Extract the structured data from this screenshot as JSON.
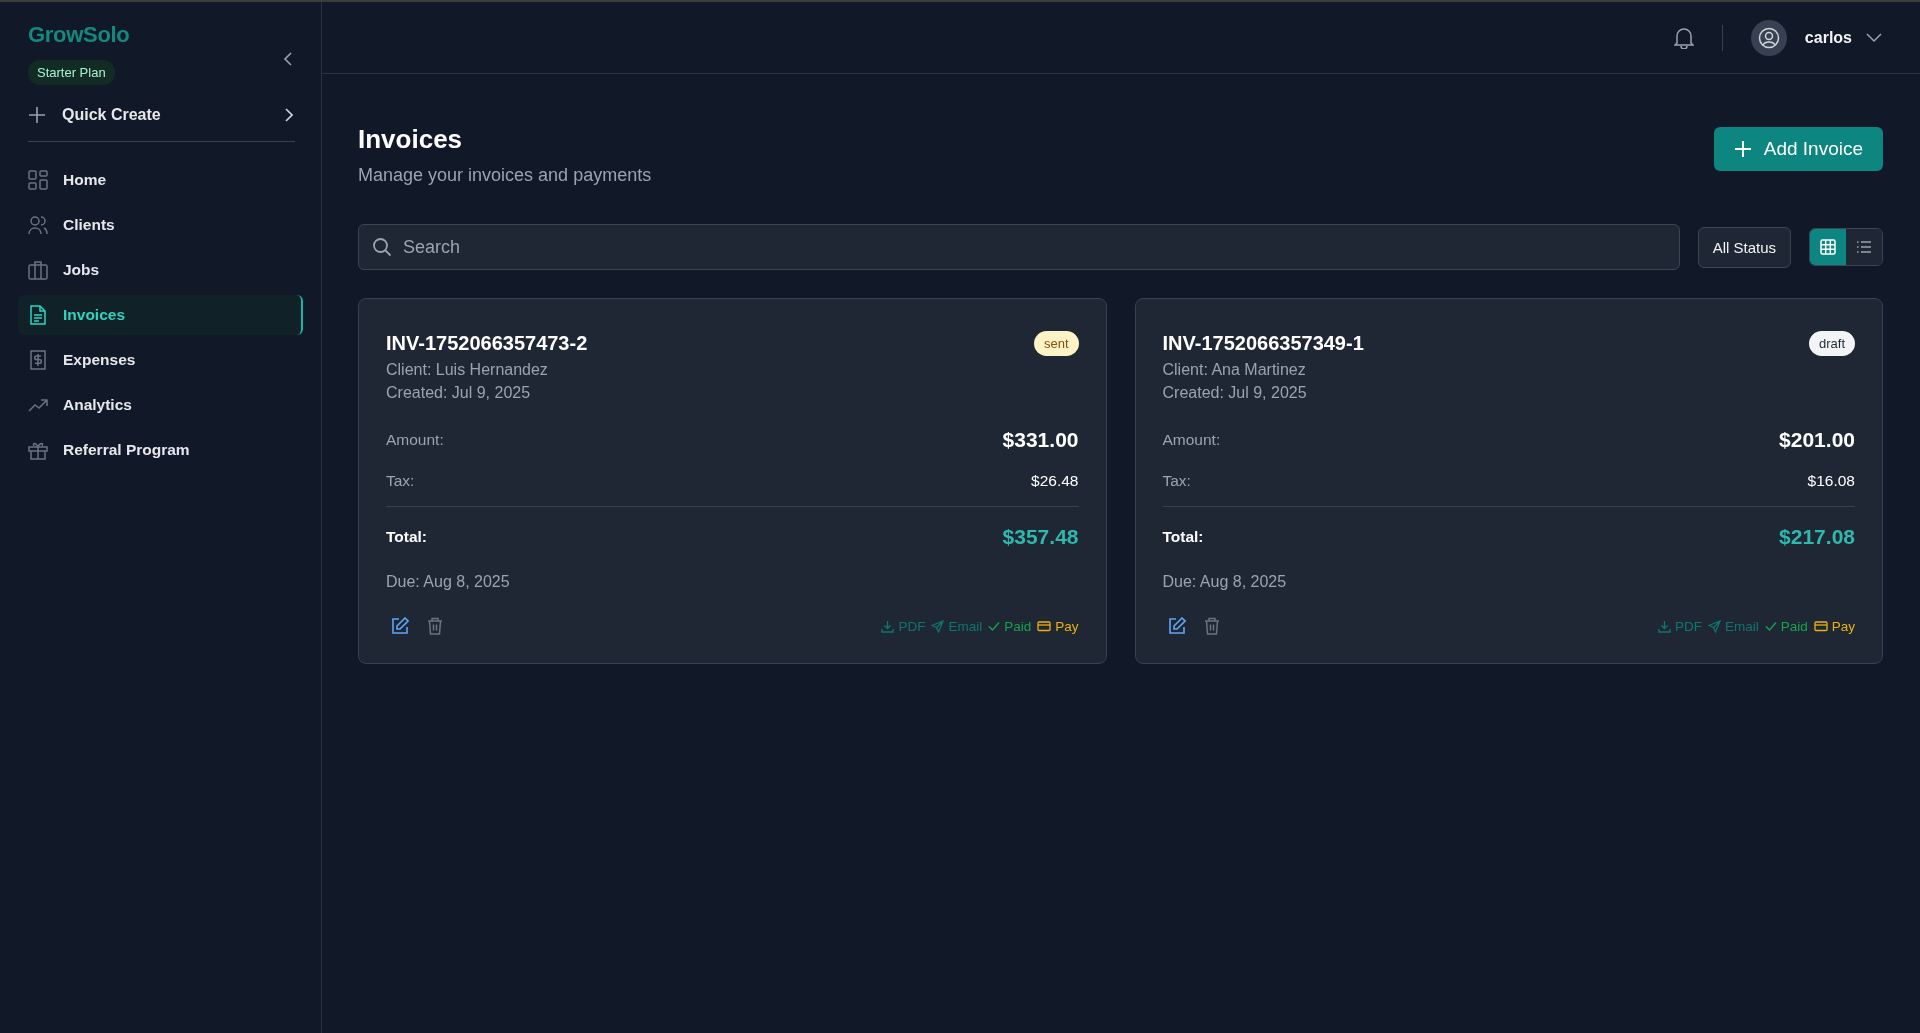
{
  "sidebar": {
    "brand": "GrowSolo",
    "plan": "Starter Plan",
    "quick_create": "Quick Create",
    "items": [
      {
        "label": "Home",
        "selected": false
      },
      {
        "label": "Clients",
        "selected": false
      },
      {
        "label": "Jobs",
        "selected": false
      },
      {
        "label": "Invoices",
        "selected": true
      },
      {
        "label": "Expenses",
        "selected": false
      },
      {
        "label": "Analytics",
        "selected": false
      },
      {
        "label": "Referral Program",
        "selected": false
      }
    ]
  },
  "header": {
    "user": "carlos"
  },
  "page": {
    "title": "Invoices",
    "subtitle": "Manage your invoices and payments",
    "add_button": "Add Invoice",
    "search": {
      "placeholder": "Search"
    },
    "status_filter": "All Status",
    "views": [
      {
        "kind": "grid",
        "selected": true
      },
      {
        "kind": "list",
        "selected": false
      }
    ]
  },
  "invoices": [
    {
      "number": "INV-1752066357473-2",
      "status": "sent",
      "client": "Client: Luis Hernandez",
      "created": "Created: Jul 9, 2025",
      "amount_label": "Amount:",
      "amount": "$331.00",
      "tax_label": "Tax:",
      "tax": "$26.48",
      "total_label": "Total:",
      "total": "$357.48",
      "due": "Due: Aug 8, 2025",
      "actions": [
        {
          "kind": "pdf",
          "label": "PDF"
        },
        {
          "kind": "email",
          "label": "Email"
        },
        {
          "kind": "paid",
          "label": "Paid"
        },
        {
          "kind": "pay",
          "label": "Pay"
        }
      ]
    },
    {
      "number": "INV-1752066357349-1",
      "status": "draft",
      "client": "Client: Ana Martinez",
      "created": "Created: Jul 9, 2025",
      "amount_label": "Amount:",
      "amount": "$201.00",
      "tax_label": "Tax:",
      "tax": "$16.08",
      "total_label": "Total:",
      "total": "$217.08",
      "due": "Due: Aug 8, 2025",
      "actions": [
        {
          "kind": "pdf",
          "label": "PDF"
        },
        {
          "kind": "email",
          "label": "Email"
        },
        {
          "kind": "paid",
          "label": "Paid"
        },
        {
          "kind": "pay",
          "label": "Pay"
        }
      ]
    }
  ]
}
